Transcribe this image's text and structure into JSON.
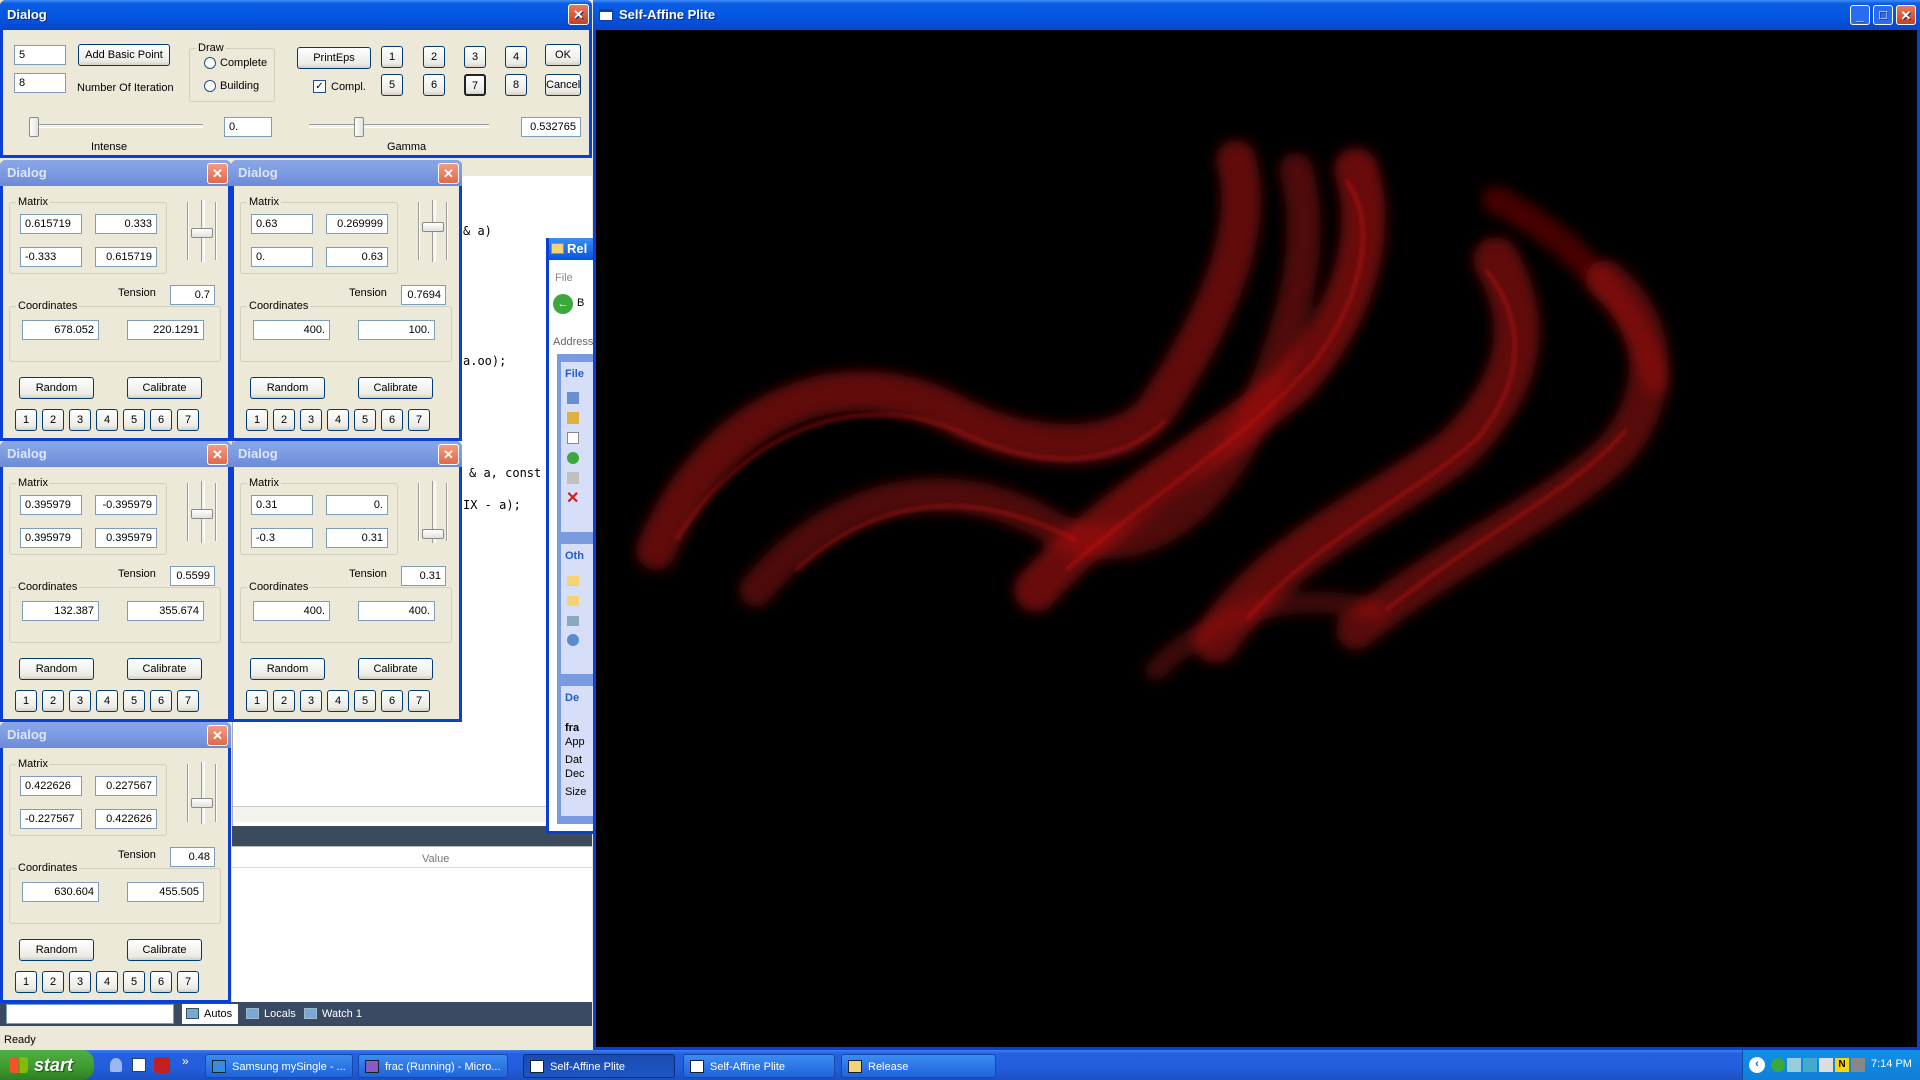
{
  "main_dialog": {
    "title": "Dialog",
    "basic_point_value": "5",
    "add_basic_point_label": "Add Basic Point",
    "iterations_value": "8",
    "iterations_label": "Number Of Iteration",
    "draw_group_label": "Draw",
    "radio_complete": "Complete",
    "radio_building": "Building",
    "printeps_label": "PrintEps",
    "compl_label": "Compl.",
    "compl_checked": true,
    "num_buttons": [
      "1",
      "2",
      "3",
      "4",
      "5",
      "6",
      "7",
      "8"
    ],
    "selected_num": "7",
    "ok_label": "OK",
    "cancel_label": "Cancel",
    "intense_value": "0.",
    "intense_label": "Intense",
    "gamma_value": "0.532765",
    "gamma_label": "Gamma"
  },
  "sub_dialogs": [
    {
      "title": "Dialog",
      "matrix_label": "Matrix",
      "m00": "0.615719",
      "m01": "0.333",
      "m10": "-0.333",
      "m11": "0.615719",
      "tension_label": "Tension",
      "tension": "0.7",
      "coords_label": "Coordinates",
      "cx": "678.052",
      "cy": "220.1291",
      "random_label": "Random",
      "calibrate_label": "Calibrate",
      "nums": [
        "1",
        "2",
        "3",
        "4",
        "5",
        "6",
        "7"
      ]
    },
    {
      "title": "Dialog",
      "matrix_label": "Matrix",
      "m00": "0.63",
      "m01": "0.269999",
      "m10": "0.",
      "m11": "0.63",
      "tension_label": "Tension",
      "tension": "0.7694",
      "coords_label": "Coordinates",
      "cx": "400.",
      "cy": "100.",
      "random_label": "Random",
      "calibrate_label": "Calibrate",
      "nums": [
        "1",
        "2",
        "3",
        "4",
        "5",
        "6",
        "7"
      ]
    },
    {
      "title": "Dialog",
      "matrix_label": "Matrix",
      "m00": "0.395979",
      "m01": "-0.395979",
      "m10": "0.395979",
      "m11": "0.395979",
      "tension_label": "Tension",
      "tension": "0.5599",
      "coords_label": "Coordinates",
      "cx": "132.387",
      "cy": "355.674",
      "random_label": "Random",
      "calibrate_label": "Calibrate",
      "nums": [
        "1",
        "2",
        "3",
        "4",
        "5",
        "6",
        "7"
      ]
    },
    {
      "title": "Dialog",
      "matrix_label": "Matrix",
      "m00": "0.31",
      "m01": "0.",
      "m10": "-0.3",
      "m11": "0.31",
      "tension_label": "Tension",
      "tension": "0.31",
      "coords_label": "Coordinates",
      "cx": "400.",
      "cy": "400.",
      "random_label": "Random",
      "calibrate_label": "Calibrate",
      "nums": [
        "1",
        "2",
        "3",
        "4",
        "5",
        "6",
        "7"
      ]
    },
    {
      "title": "Dialog",
      "matrix_label": "Matrix",
      "m00": "0.422626",
      "m01": "0.227567",
      "m10": "-0.227567",
      "m11": "0.422626",
      "tension_label": "Tension",
      "tension": "0.48",
      "coords_label": "Coordinates",
      "cx": "630.604",
      "cy": "455.505",
      "random_label": "Random",
      "calibrate_label": "Calibrate",
      "nums": [
        "1",
        "2",
        "3",
        "4",
        "5",
        "6",
        "7"
      ]
    }
  ],
  "code_editor": {
    "lines": [
      "& a)",
      "a.oo);",
      "& a, const",
      "IX - a);"
    ],
    "watch_value_header": "Value"
  },
  "debug_tabs": [
    "Autos",
    "Locals",
    "Watch 1"
  ],
  "status_text": "Ready",
  "explorer": {
    "title": "Rel",
    "menu_file": "File",
    "back_label": "B",
    "address_label": "Address",
    "tasks_head": "File",
    "other_head": "Oth",
    "details_head": "De",
    "details_name": "fra",
    "details_lines": [
      "App",
      "Dat",
      "Dec",
      "Size"
    ]
  },
  "render_window": {
    "title": "Self-Affine Plite",
    "fractal_color": "#b01010"
  },
  "taskbar": {
    "start_label": "start",
    "items": [
      {
        "label": "Samsung mySingle - ...",
        "icon": "ie-icon"
      },
      {
        "label": "frac (Running) - Micro...",
        "icon": "vs-icon"
      },
      {
        "label": "Self-Affine Plite",
        "icon": "window-icon"
      },
      {
        "label": "Self-Affine Plite",
        "icon": "window-icon"
      },
      {
        "label": "Release",
        "icon": "folder-icon"
      }
    ],
    "clock": "7:14 PM"
  },
  "colors": {
    "xp_blue": "#0a5de3",
    "taskbar": "#245edb",
    "start_green": "#3c9a2f",
    "dialog_bg": "#ece9d8"
  }
}
